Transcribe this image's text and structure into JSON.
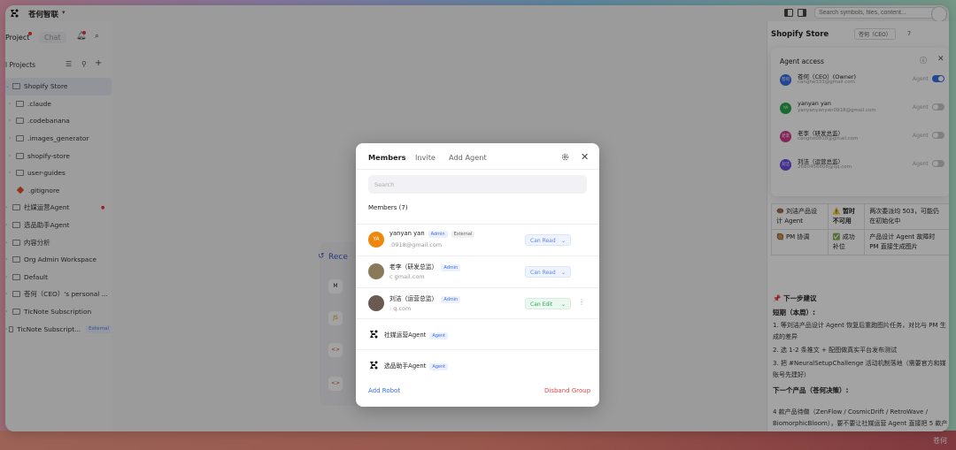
{
  "app": {
    "org_name": "苍何智联",
    "search_placeholder": "Search symbols, files, content...",
    "bottom_corner_text": "苍何"
  },
  "sidebar": {
    "tabs": [
      {
        "label": "Project"
      },
      {
        "label": "Chat"
      }
    ],
    "projects_title": "l Projects",
    "items": [
      {
        "label": "Shopify Store",
        "kind": "root",
        "selected": true
      },
      {
        "label": ".claude",
        "kind": "folder"
      },
      {
        "label": ".codebanana",
        "kind": "folder"
      },
      {
        "label": ".images_generator",
        "kind": "folder"
      },
      {
        "label": "shopify-store",
        "kind": "folder"
      },
      {
        "label": "user-guides",
        "kind": "folder"
      },
      {
        "label": ".gitignore",
        "kind": "file"
      },
      {
        "label": "社媒运营Agent",
        "kind": "root"
      },
      {
        "label": "选品助手Agent",
        "kind": "root"
      },
      {
        "label": "内容分析",
        "kind": "root"
      },
      {
        "label": "Org Admin Workspace",
        "kind": "root"
      },
      {
        "label": "Default",
        "kind": "root"
      },
      {
        "label": "苍何（CEO）'s personal ...",
        "kind": "root"
      },
      {
        "label": "TicNote Subscription",
        "kind": "root"
      },
      {
        "label": "TicNote Subscript...",
        "kind": "root",
        "tag": "External"
      }
    ]
  },
  "center": {
    "recent_title": "Rece",
    "recent_items": [
      {
        "badge": "M"
      },
      {
        "badge": "JS"
      },
      {
        "badge": "<>"
      },
      {
        "badge": "<>"
      }
    ]
  },
  "right_panel": {
    "title": "Shopify Store",
    "ceo_chip": "苍何（CEO）",
    "member_count": "7",
    "agent_access": {
      "title": "Agent access",
      "rows": [
        {
          "initials": "苍何",
          "name": "苍何（CEO）(Owner)",
          "email": "canghe333@gmail.com",
          "label": "Agent",
          "on": true,
          "color": "#3b6ee6"
        },
        {
          "initials": "YA",
          "name": "yanyan yan",
          "email": "yanyanyanyan0918@gmail.com",
          "label": "Agent",
          "on": false,
          "color": "#2aa84a"
        },
        {
          "initials": "老李",
          "name": "老李（研发总监）",
          "email": "canghe0818@gmail.com",
          "label": "Agent",
          "on": false,
          "color": "#d03a8c"
        },
        {
          "initials": "刘洁",
          "name": "刘洁（运营总监）",
          "email": "2680456608@qq.com",
          "label": "Agent",
          "on": false,
          "color": "#6a4be0"
        }
      ]
    },
    "table": [
      [
        "🍩 刘洁产品设计 Agent",
        "⚠️ 暂时不可用",
        "两次委派均 503，可能仍在初始化中"
      ],
      [
        "🥘 PM 协调",
        "✅ 成功补位",
        "产品设计 Agent 故障时 PM 直接生成图片"
      ]
    ],
    "next_title": "📌 下一步建议",
    "short_term": "短期（本周）:",
    "steps": [
      "1. 等刘洁产品设计 Agent 恢复后重跑图片任务，对比与 PM 生成的差异",
      "2. 选 1-2 条推文 + 配图做真实平台发布测试",
      "3. 把 #NeuralSetupChallenge 活动机制落地（需要官方和媒账号先建好）"
    ],
    "next_product_title": "下一个产品（苍何决策）:",
    "next_product_text": "4 款产品待做（ZenFlow / CosmicDrift / RetroWave / BiomorphicBloom），要不要让社媒运营 Agent 直接把 5 款产品的 30 天内容日历一次性生成出来?"
  },
  "modal": {
    "tabs": [
      {
        "label": "Members",
        "active": true
      },
      {
        "label": "Invite"
      },
      {
        "label": "Add Agent"
      }
    ],
    "search_placeholder": "Search",
    "members_title": "Members (7)",
    "members": [
      {
        "name": "yanyan yan",
        "tags": [
          "Admin",
          "External"
        ],
        "email": "                .0918@gmail.com",
        "permission": "Can Read",
        "avatar_text": "YA",
        "avatar_color": "#f0870d"
      },
      {
        "name": "老李（研发总监）",
        "tags": [
          "Admin"
        ],
        "email": "c                    gmail.com",
        "permission": "Can Read",
        "avatar_text": "",
        "avatar_color": "#8a7a5a"
      },
      {
        "name": "刘洁（运营总监）",
        "tags": [
          "Admin"
        ],
        "email": ":                     q.com",
        "permission": "Can Edit",
        "avatar_text": "",
        "avatar_color": "#6a5a52"
      }
    ],
    "agents": [
      {
        "name": "社媒运营Agent",
        "tag": "Agent"
      },
      {
        "name": "选品助手Agent",
        "tag": "Agent"
      }
    ],
    "footer": {
      "add_robot": "Add Robot",
      "disband": "Disband Group"
    }
  }
}
